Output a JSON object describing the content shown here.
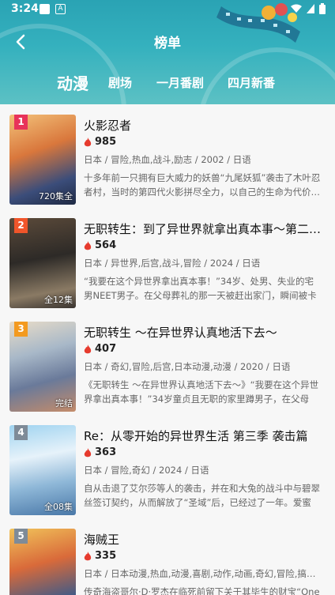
{
  "status": {
    "time": "3:24"
  },
  "header": {
    "title": "榜单"
  },
  "tabs": [
    {
      "label": "动漫",
      "active": true
    },
    {
      "label": "剧场",
      "active": false
    },
    {
      "label": "一月番剧",
      "active": false
    },
    {
      "label": "四月新番",
      "active": false
    }
  ],
  "items": [
    {
      "rank": "1",
      "rank_color": "#e8335a",
      "title": "火影忍者",
      "heat": "985",
      "meta": "日本 / 冒险,热血,战斗,励志 / 2002 / 日语",
      "desc": "十多年前一只拥有巨大威力的妖兽“九尾妖狐”袭击了木叶忍者村，当时的第四代火影拼尽全力，以自己的生命为代价…",
      "episodes": "720集全"
    },
    {
      "rank": "2",
      "rank_color": "#f0552a",
      "title": "无职转生：到了异世界就拿出真本事～第二…",
      "heat": "564",
      "meta": "日本 / 异世界,后宫,战斗,冒险 / 2024 / 日语",
      "desc": "“我要在这个异世界拿出真本事！”34岁、处男、失业的宅男NEET男子。在父母葬礼的那一天被赶出家门，瞬间被卡车…",
      "episodes": "全12集"
    },
    {
      "rank": "3",
      "rank_color": "#f39a1f",
      "title": "无职转生 ～在异世界认真地活下去～",
      "heat": "407",
      "meta": "日本 / 奇幻,冒险,后宫,日本动漫,动漫 / 2020 / 日语",
      "desc": "《无职转生 ～在异世界认真地活下去～》“我要在这个异世界拿出真本事！”34岁童贞且无职的家里蹲男子，在父母的…",
      "episodes": "完结"
    },
    {
      "rank": "4",
      "rank_color": "#7e8b98",
      "title": "Re：从零开始的异世界生活 第三季 袭击篇",
      "heat": "363",
      "meta": "日本 / 冒险,奇幻 / 2024 / 日语",
      "desc": "自从击退了艾尔莎等人的袭击，并在和大兔的战斗中与碧翠丝签订契约，从而解放了“圣域”后，已经过了一年。爱蜜莉…",
      "episodes": "全08集"
    },
    {
      "rank": "5",
      "rank_color": "#7e8b98",
      "title": "海贼王",
      "heat": "335",
      "meta": "日本 / 日本动漫,热血,动漫,喜剧,动作,动画,奇幻,冒险,搞笑 / …",
      "desc": "传奇海盗哥尔·D·罗杰在临死前留下关于其毕生的财宝“One Piece”…",
      "episodes": ""
    }
  ]
}
